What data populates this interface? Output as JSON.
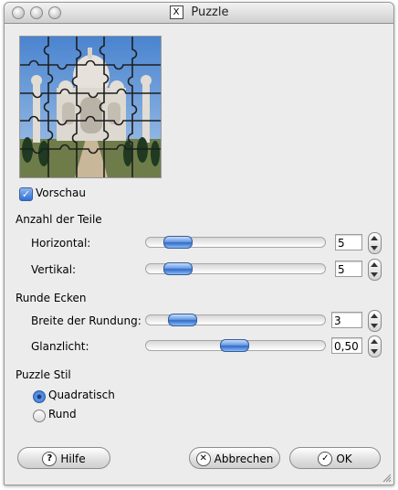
{
  "window": {
    "title": "Puzzle",
    "title_icon": "X"
  },
  "preview": {
    "caption": ""
  },
  "checkbox_preview": {
    "label": "Vorschau",
    "checked": true
  },
  "pieces_section": {
    "heading": "Anzahl der Teile",
    "horizontal": {
      "label": "Horizontal:",
      "value": "5",
      "level": 0.12
    },
    "vertical": {
      "label": "Vertikal:",
      "value": "5",
      "level": 0.12
    }
  },
  "corners_section": {
    "heading": "Runde Ecken",
    "radius": {
      "label": "Breite der Rundung:",
      "value": "3",
      "level": 0.15
    },
    "highlight": {
      "label": "Glanzlicht:",
      "value": "0,50",
      "level": 0.5
    }
  },
  "style_section": {
    "heading": "Puzzle Stil",
    "options": [
      {
        "label": "Quadratisch",
        "selected": true
      },
      {
        "label": "Rund",
        "selected": false
      }
    ]
  },
  "buttons": {
    "help": "Hilfe",
    "cancel": "Abbrechen",
    "ok": "OK"
  },
  "icons": {
    "help": "help-icon",
    "cancel": "cancel-icon",
    "ok": "check-icon",
    "stepper": "stepper-icon",
    "close": "close-icon"
  },
  "colors": {
    "accent": "#2e6fd6",
    "window_bg": "#ececec"
  }
}
